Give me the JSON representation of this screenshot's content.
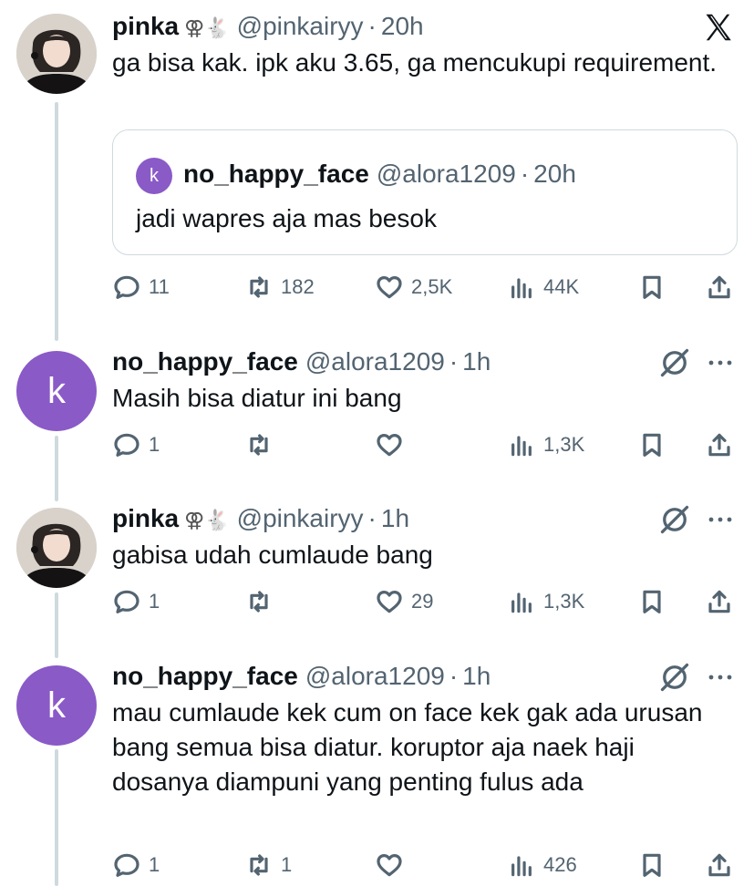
{
  "tweets": [
    {
      "name": "pinka",
      "emoji": "⚢🐇",
      "handle": "@pinkairyy",
      "sep": "·",
      "time": "20h",
      "text": "ga bisa kak. ipk aku 3.65, ga mencukupi requirement.",
      "quote": {
        "avatar_letter": "k",
        "name": "no_happy_face",
        "handle": "@alora1209",
        "sep": "·",
        "time": "20h",
        "text": "jadi wapres aja mas besok"
      },
      "stats": {
        "replies": "11",
        "retweets": "182",
        "likes": "2,5K",
        "views": "44K"
      }
    },
    {
      "avatar_letter": "k",
      "name": "no_happy_face",
      "handle": "@alora1209",
      "sep": "·",
      "time": "1h",
      "text": "Masih bisa diatur ini bang",
      "stats": {
        "replies": "1",
        "retweets": "",
        "likes": "",
        "views": "1,3K"
      }
    },
    {
      "name": "pinka",
      "emoji": "⚢🐇",
      "handle": "@pinkairyy",
      "sep": "·",
      "time": "1h",
      "text": "gabisa udah cumlaude bang",
      "stats": {
        "replies": "1",
        "retweets": "",
        "likes": "29",
        "views": "1,3K"
      }
    },
    {
      "avatar_letter": "k",
      "name": "no_happy_face",
      "handle": "@alora1209",
      "sep": "·",
      "time": "1h",
      "text": "mau cumlaude kek cum on face kek gak ada urusan bang semua bisa diatur. koruptor aja naek haji dosanya diampuni yang penting fulus ada",
      "stats": {
        "replies": "1",
        "retweets": "1",
        "likes": "",
        "views": "426"
      }
    }
  ],
  "icons": {
    "brand": "x-logo-icon",
    "reply": "reply-icon",
    "retweet": "retweet-icon",
    "like": "heart-icon",
    "views": "views-icon",
    "bookmark": "bookmark-icon",
    "share": "share-icon",
    "grok": "grok-icon",
    "more": "more-icon"
  },
  "colors": {
    "avatar_k": "#8a5ac7",
    "muted": "#536471",
    "text": "#0f1419",
    "divider": "#cfd9de"
  }
}
